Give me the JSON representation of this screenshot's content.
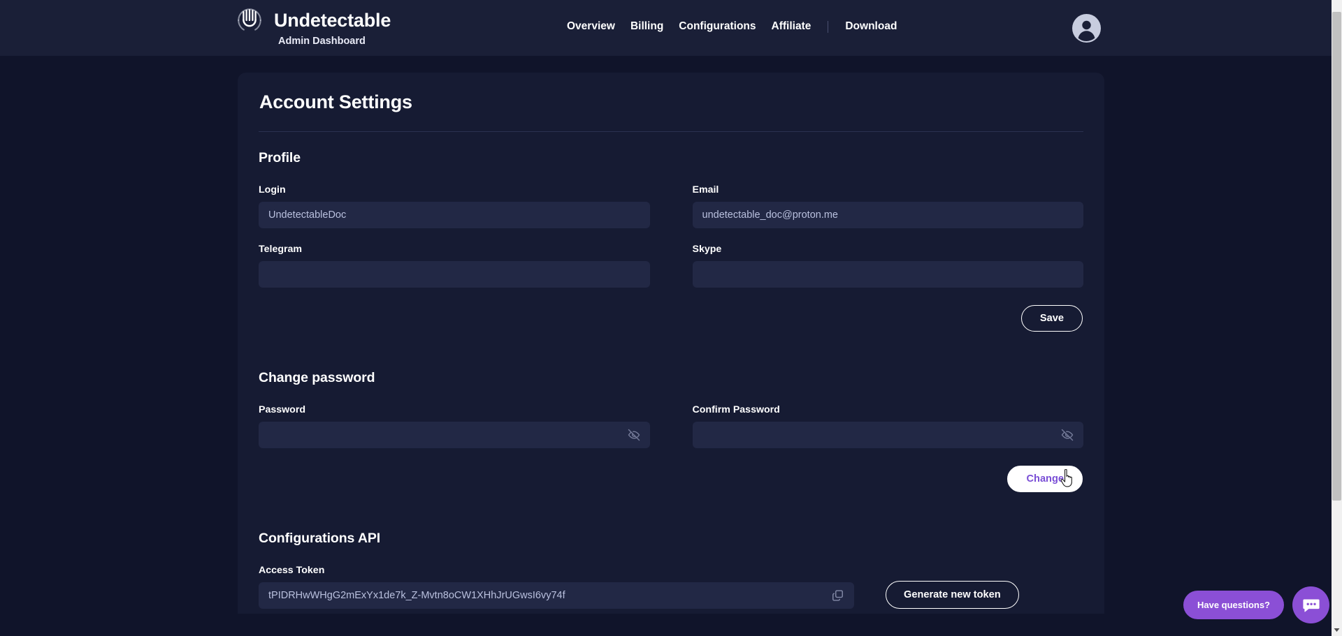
{
  "header": {
    "brand_title": "Undetectable",
    "brand_subtitle": "Admin Dashboard",
    "logo_icon": "fingerprint-icon",
    "nav": [
      {
        "label": "Overview"
      },
      {
        "label": "Billing"
      },
      {
        "label": "Configurations"
      },
      {
        "label": "Affiliate"
      },
      {
        "label": "Download"
      }
    ],
    "avatar_icon": "user-avatar-icon"
  },
  "page": {
    "title": "Account Settings"
  },
  "profile": {
    "section_title": "Profile",
    "login_label": "Login",
    "login_value": "UndetectableDoc",
    "login_placeholder": "",
    "email_label": "Email",
    "email_value": "undetectable_doc@proton.me",
    "email_placeholder": "",
    "telegram_label": "Telegram",
    "telegram_value": "",
    "telegram_placeholder": "",
    "skype_label": "Skype",
    "skype_value": "",
    "skype_placeholder": "",
    "save_label": "Save"
  },
  "password": {
    "section_title": "Change password",
    "password_label": "Password",
    "password_value": "",
    "password_placeholder": "",
    "confirm_label": "Confirm Password",
    "confirm_value": "",
    "confirm_placeholder": "",
    "change_label": "Change",
    "toggle_icon": "eye-off-icon"
  },
  "api": {
    "section_title": "Configurations API",
    "token_label": "Access Token",
    "token_value": "tPIDRHwWHgG2mExYx1de7k_Z-Mvtn8oCW1XHhJrUGwsI6vy74f",
    "copy_icon": "copy-icon",
    "generate_label": "Generate new token"
  },
  "chat": {
    "pill_label": "Have questions?",
    "button_icon": "chat-bubble-icon"
  },
  "colors": {
    "page_bg": "#10142a",
    "header_bg": "#1a1f37",
    "card_bg": "#161b33",
    "input_bg": "#222845",
    "accent_purple": "#8b4fd6",
    "text": "#ffffff",
    "muted_text": "#b9c0de"
  }
}
